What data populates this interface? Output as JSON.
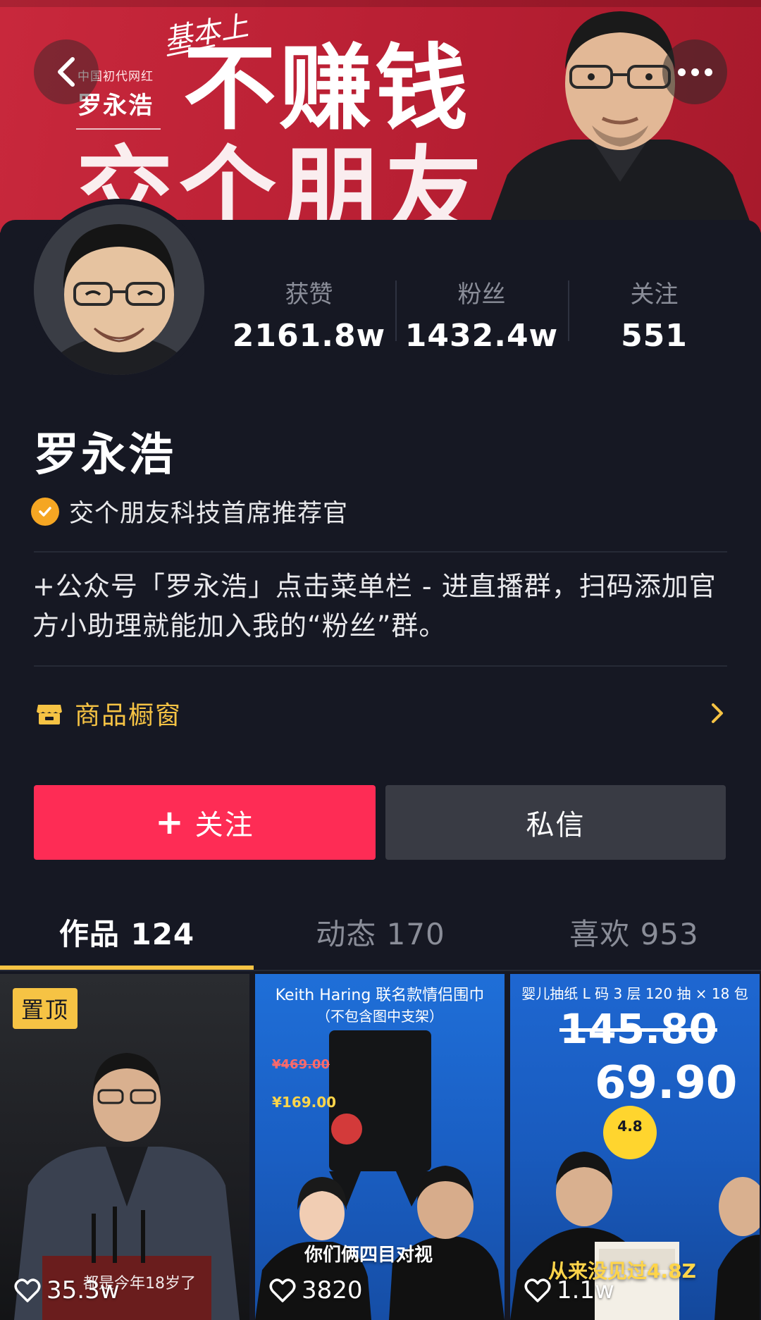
{
  "banner": {
    "kicker": "中国初代网红",
    "name": "罗永浩",
    "script": "基本上",
    "line1": "不赚钱",
    "line2": "交个朋友"
  },
  "profile": {
    "name": "罗永浩",
    "verified_title": "交个朋友科技首席推荐官",
    "bio": "+公众号「罗永浩」点击菜单栏 - 进直播群，扫码添加官方小助理就能加入我的“粉丝”群。",
    "stats": [
      {
        "label": "获赞",
        "value": "2161.8w"
      },
      {
        "label": "粉丝",
        "value": "1432.4w"
      },
      {
        "label": "关注",
        "value": "551"
      }
    ],
    "shop_label": "商品橱窗",
    "follow_label": "关注",
    "message_label": "私信"
  },
  "tabs": [
    {
      "label": "作品 124",
      "active": true
    },
    {
      "label": "动态 170",
      "active": false
    },
    {
      "label": "喜欢 953",
      "active": false
    }
  ],
  "videos": [
    {
      "pinned_label": "置顶",
      "likes": "35.3w",
      "caption": "都是今年18岁了"
    },
    {
      "title": "Keith Haring 联名款情侣围巾",
      "subtitle": "（不包含图中支架）",
      "price_ref": "¥469.00",
      "price_live": "¥169.00",
      "caption": "你们俩四目对视",
      "likes": "3820"
    },
    {
      "title": "婴儿抽纸 L 码 3 层 120 抽 × 18 包",
      "price_ref": "145.80",
      "price_live": "69.90",
      "discount": "4.8",
      "caption": "从来没见过4.8Z",
      "likes": "1.1w"
    }
  ],
  "colors": {
    "accent_follow": "#fe2c55",
    "tab_indicator": "#f6c344",
    "background": "#161823",
    "verify_badge": "#f5a623"
  }
}
